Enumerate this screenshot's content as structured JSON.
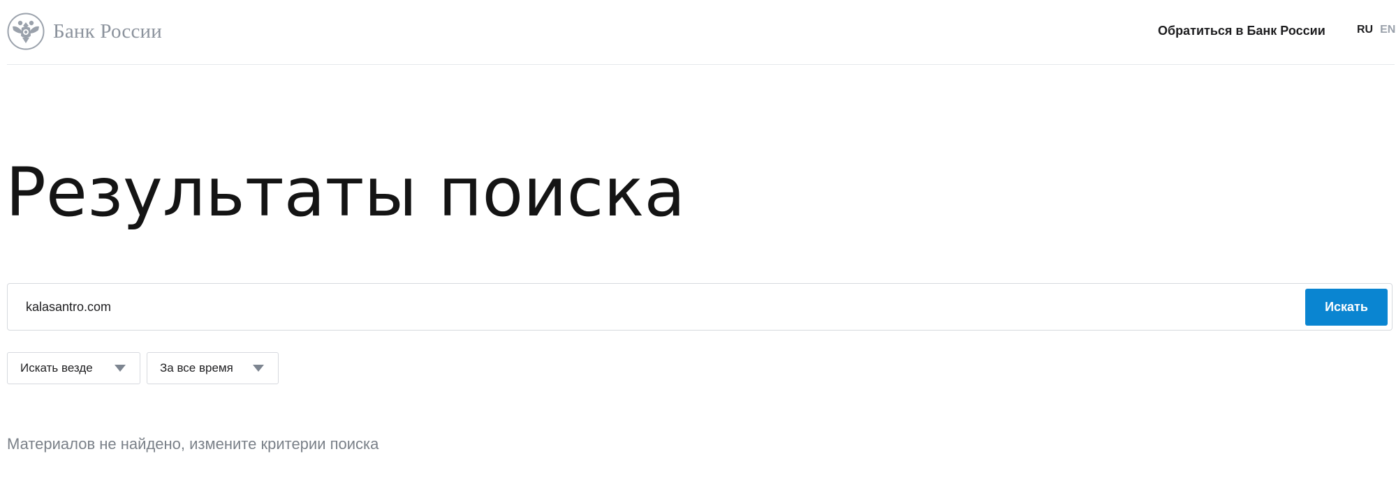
{
  "header": {
    "logo_text": "Банк России",
    "contact_link": "Обратиться в Банк России",
    "lang_ru": "RU",
    "lang_en": "EN"
  },
  "main": {
    "title": "Результаты поиска",
    "search": {
      "value": "kalasantro.com",
      "button_label": "Искать"
    },
    "filters": {
      "where_label": "Искать везде",
      "time_label": "За все время"
    },
    "empty_message": "Материалов не найдено, измените критерии поиска"
  },
  "colors": {
    "accent": "#0a85d1",
    "muted_text": "#7a8088",
    "logo_gray": "#8b929c"
  },
  "icons": {
    "logo": "double-headed-eagle-emblem-icon",
    "dropdown": "caret-down-icon"
  }
}
